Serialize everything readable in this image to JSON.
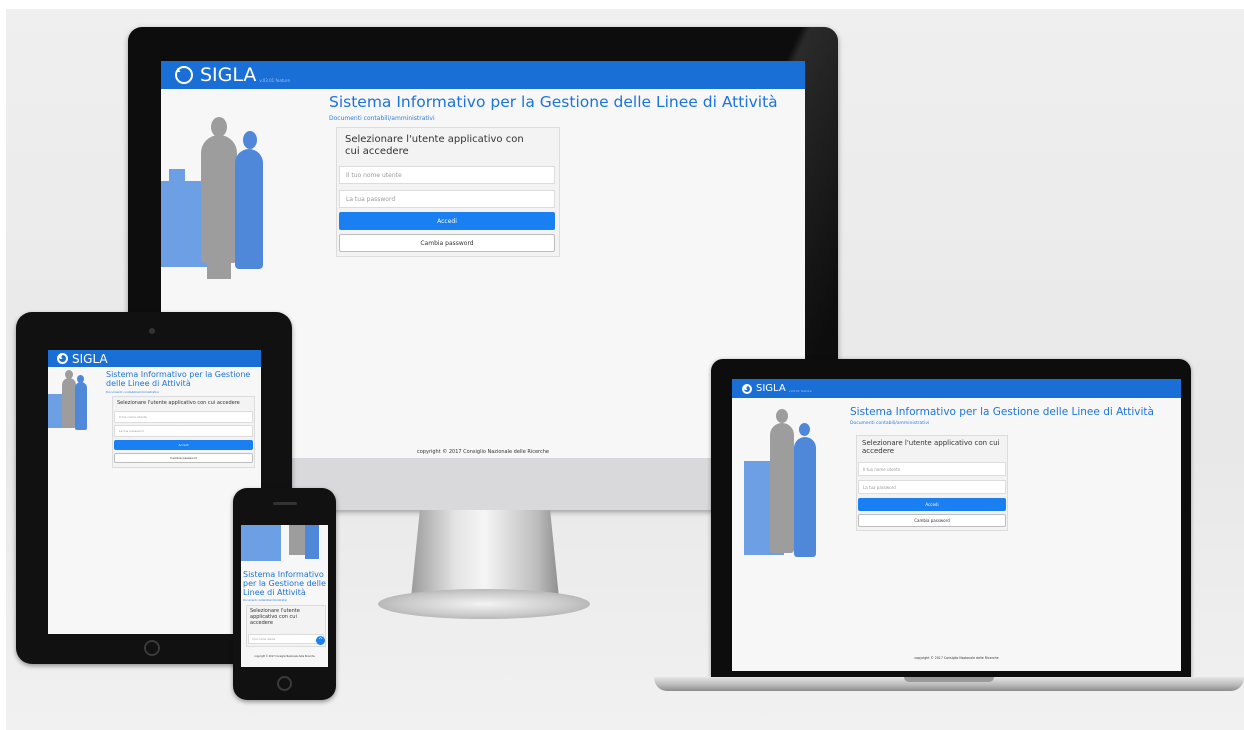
{
  "app": {
    "brand": "SIGLA",
    "version": "v.03.01 feature",
    "title": "Sistema Informativo per la Gestione delle Linee di Attività",
    "subtitle": "Documenti contabili/amministrativi"
  },
  "login": {
    "heading": "Selezionare l'utente applicativo con cui accedere",
    "username_placeholder": "Il tuo nome utente",
    "password_placeholder": "La tua password",
    "login_button": "Accedi",
    "change_password_button": "Cambia password"
  },
  "footer": {
    "copyright": "copyright © 2017 Consiglio Nazionale delle Ricerche"
  },
  "colors": {
    "header_blue": "#1a6fd6",
    "primary_button": "#1a7ff0",
    "title_blue": "#1c74db"
  },
  "icons": [
    "logo-icon",
    "chevron-up-icon"
  ]
}
